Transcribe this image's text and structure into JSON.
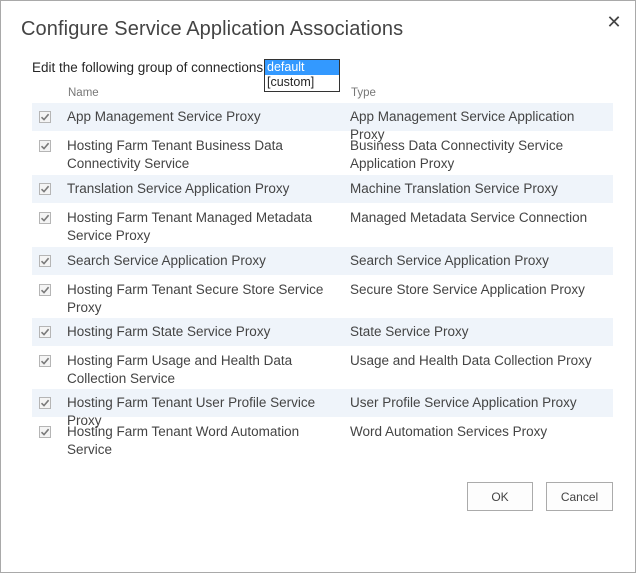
{
  "dialog": {
    "title": "Configure Service Application Associations",
    "close_glyph": "✕"
  },
  "group": {
    "label": "Edit the following group of connections:",
    "options": [
      "default",
      "[custom]"
    ],
    "selected": "default"
  },
  "columns": {
    "name": "Name",
    "type": "Type"
  },
  "rows": [
    {
      "name": "App Management Service Proxy",
      "type": "App Management Service Application Proxy",
      "checked": true
    },
    {
      "name": "Hosting Farm Tenant Business Data Connectivity Service",
      "type": "Business Data Connectivity Service Application Proxy",
      "checked": true
    },
    {
      "name": "Translation Service Application Proxy",
      "type": "Machine Translation Service Proxy",
      "checked": true
    },
    {
      "name": "Hosting Farm Tenant Managed Metadata Service Proxy",
      "type": "Managed Metadata Service Connection",
      "checked": true
    },
    {
      "name": "Search Service Application Proxy",
      "type": "Search Service Application Proxy",
      "checked": true
    },
    {
      "name": "Hosting Farm Tenant Secure Store Service Proxy",
      "type": "Secure Store Service Application Proxy",
      "checked": true
    },
    {
      "name": "Hosting Farm State Service Proxy",
      "type": "State Service Proxy",
      "checked": true
    },
    {
      "name": "Hosting Farm Usage and Health Data Collection Service",
      "type": "Usage and Health Data Collection Proxy",
      "checked": true
    },
    {
      "name": "Hosting Farm Tenant User Profile Service Proxy",
      "type": "User Profile Service Application Proxy",
      "checked": true
    },
    {
      "name": "Hosting Farm Tenant Word Automation Service",
      "type": "Word Automation Services Proxy",
      "checked": true
    }
  ],
  "buttons": {
    "ok": "OK",
    "cancel": "Cancel"
  },
  "colors": {
    "selection": "#3399ff",
    "alt_row": "#eff4fa",
    "check": "#7a7a7a"
  }
}
